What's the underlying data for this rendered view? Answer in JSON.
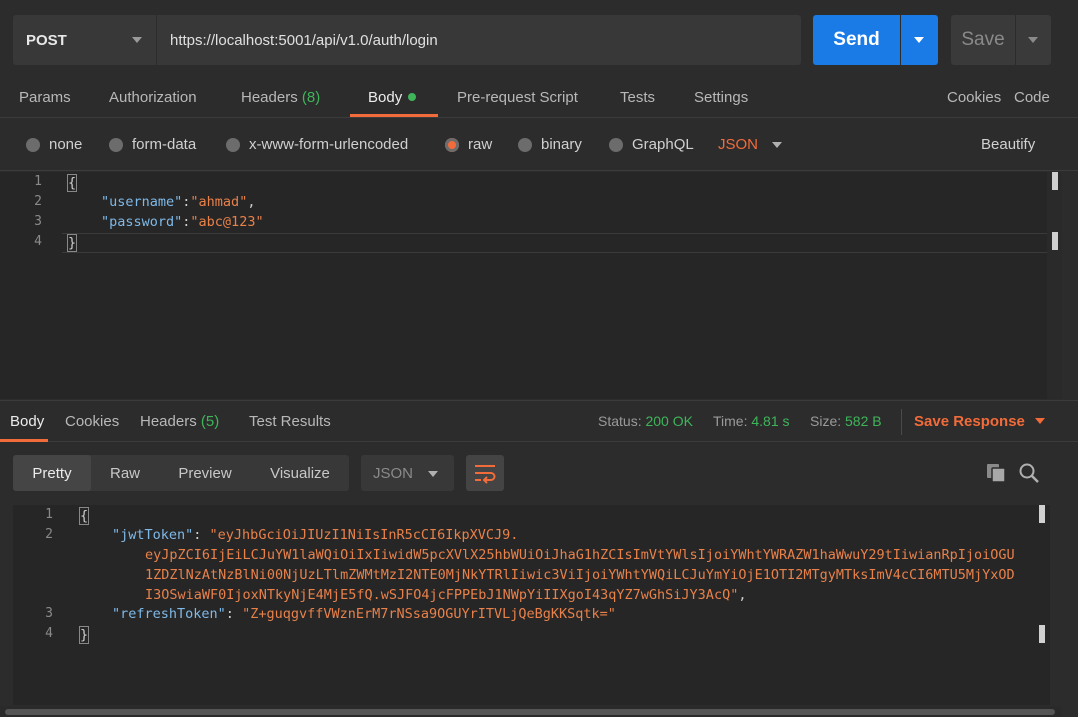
{
  "request": {
    "method": "POST",
    "url": "https://localhost:5001/api/v1.0/auth/login",
    "send_label": "Send",
    "save_label": "Save"
  },
  "request_tabs": {
    "params": "Params",
    "authorization": "Authorization",
    "headers": "Headers",
    "headers_count": "(8)",
    "body": "Body",
    "pre_request": "Pre-request Script",
    "tests": "Tests",
    "settings": "Settings",
    "cookies": "Cookies",
    "code": "Code"
  },
  "body_types": {
    "none": "none",
    "form_data": "form-data",
    "urlencoded": "x-www-form-urlencoded",
    "raw": "raw",
    "binary": "binary",
    "graphql": "GraphQL",
    "format": "JSON",
    "beautify": "Beautify",
    "selected": "raw"
  },
  "request_body": {
    "line_numbers": [
      "1",
      "2",
      "3",
      "4"
    ],
    "open_brace": "{",
    "close_brace": "}",
    "username_key": "\"username\"",
    "username_value": "\"ahmad\"",
    "password_key": "\"password\"",
    "password_value": "\"abc@123\""
  },
  "response_tabs": {
    "body": "Body",
    "cookies": "Cookies",
    "headers": "Headers",
    "headers_count": "(5)",
    "test_results": "Test Results"
  },
  "response_status": {
    "status_label": "Status:",
    "status_value": "200 OK",
    "time_label": "Time:",
    "time_value": "4.81 s",
    "size_label": "Size:",
    "size_value": "582 B",
    "save_response": "Save Response"
  },
  "response_view": {
    "pretty": "Pretty",
    "raw": "Raw",
    "preview": "Preview",
    "visualize": "Visualize",
    "format": "JSON"
  },
  "response_body": {
    "line_numbers": [
      "1",
      "2",
      "3",
      "4"
    ],
    "open_brace": "{",
    "close_brace": "}",
    "jwt_key": "\"jwtToken\"",
    "jwt_line1": "\"eyJhbGciOiJIUzI1NiIsInR5cCI6IkpXVCJ9.",
    "jwt_line2": "eyJpZCI6IjEiLCJuYW1laWQiOiIxIiwidW5pcXVlX25hbWUiOiJhaG1hZCIsImVtYWlsIjoiYWhtYWRAZW1haWwuY29tIiwianRpIjoiOGU",
    "jwt_line3": "1ZDZlNzAtNzBlNi00NjUzLTlmZWMtMzI2NTE0MjNkYTRlIiwic3ViIjoiYWhtYWQiLCJuYmYiOjE1OTI2MTgyMTksImV4cCI6MTU5MjYxOD",
    "jwt_line4": "I3OSwiaWF0IjoxNTkyNjE4MjE5fQ.wSJFO4jcFPPEbJ1NWpYiIIXgoI43qYZ7wGhSiJY3AcQ\"",
    "refresh_key": "\"refreshToken\"",
    "refresh_value": "\"Z+guqgvffVWznErM7rNSsa9OGUYrITVLjQeBgKKSqtk=\""
  },
  "colors": {
    "accent": "#f26b3a",
    "send": "#1a7be6",
    "success": "#3fb55a",
    "json_key": "#7fb9e8",
    "json_string": "#e8814a"
  }
}
